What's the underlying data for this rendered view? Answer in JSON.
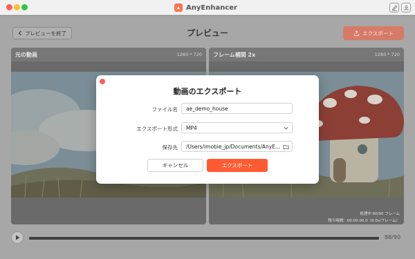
{
  "window": {
    "app_name": "AnyEnhancer",
    "edit_icon": "edit-icon",
    "user_icon": "user-icon"
  },
  "toolbar": {
    "back_label": "プレビューを終了",
    "title": "プレビュー",
    "export_label": "エクスポート"
  },
  "panels": {
    "left": {
      "label": "元の動画",
      "resolution": "1280 * 720"
    },
    "right": {
      "label": "フレーム補間 2x",
      "resolution": "1280 * 720",
      "status_frames": "処理中 90/90 フレーム",
      "status_time": "残り時間：00:00:00.0（0.0s/フレーム）"
    }
  },
  "playback": {
    "progress": 1.0,
    "frame_counter": "88/90"
  },
  "dialog": {
    "title": "動画のエクスポート",
    "filename_label": "ファイル名",
    "filename_value": "ae_demo_house",
    "format_label": "エクスポート形式",
    "format_value": "MP4",
    "path_label": "保存先",
    "path_value": "/Users/imobie_jp/Documents/AnyE...",
    "cancel_label": "キャンセル",
    "export_label": "エクスポート"
  },
  "colors": {
    "accent": "#ff5b33",
    "close_red": "#ff5f57"
  }
}
